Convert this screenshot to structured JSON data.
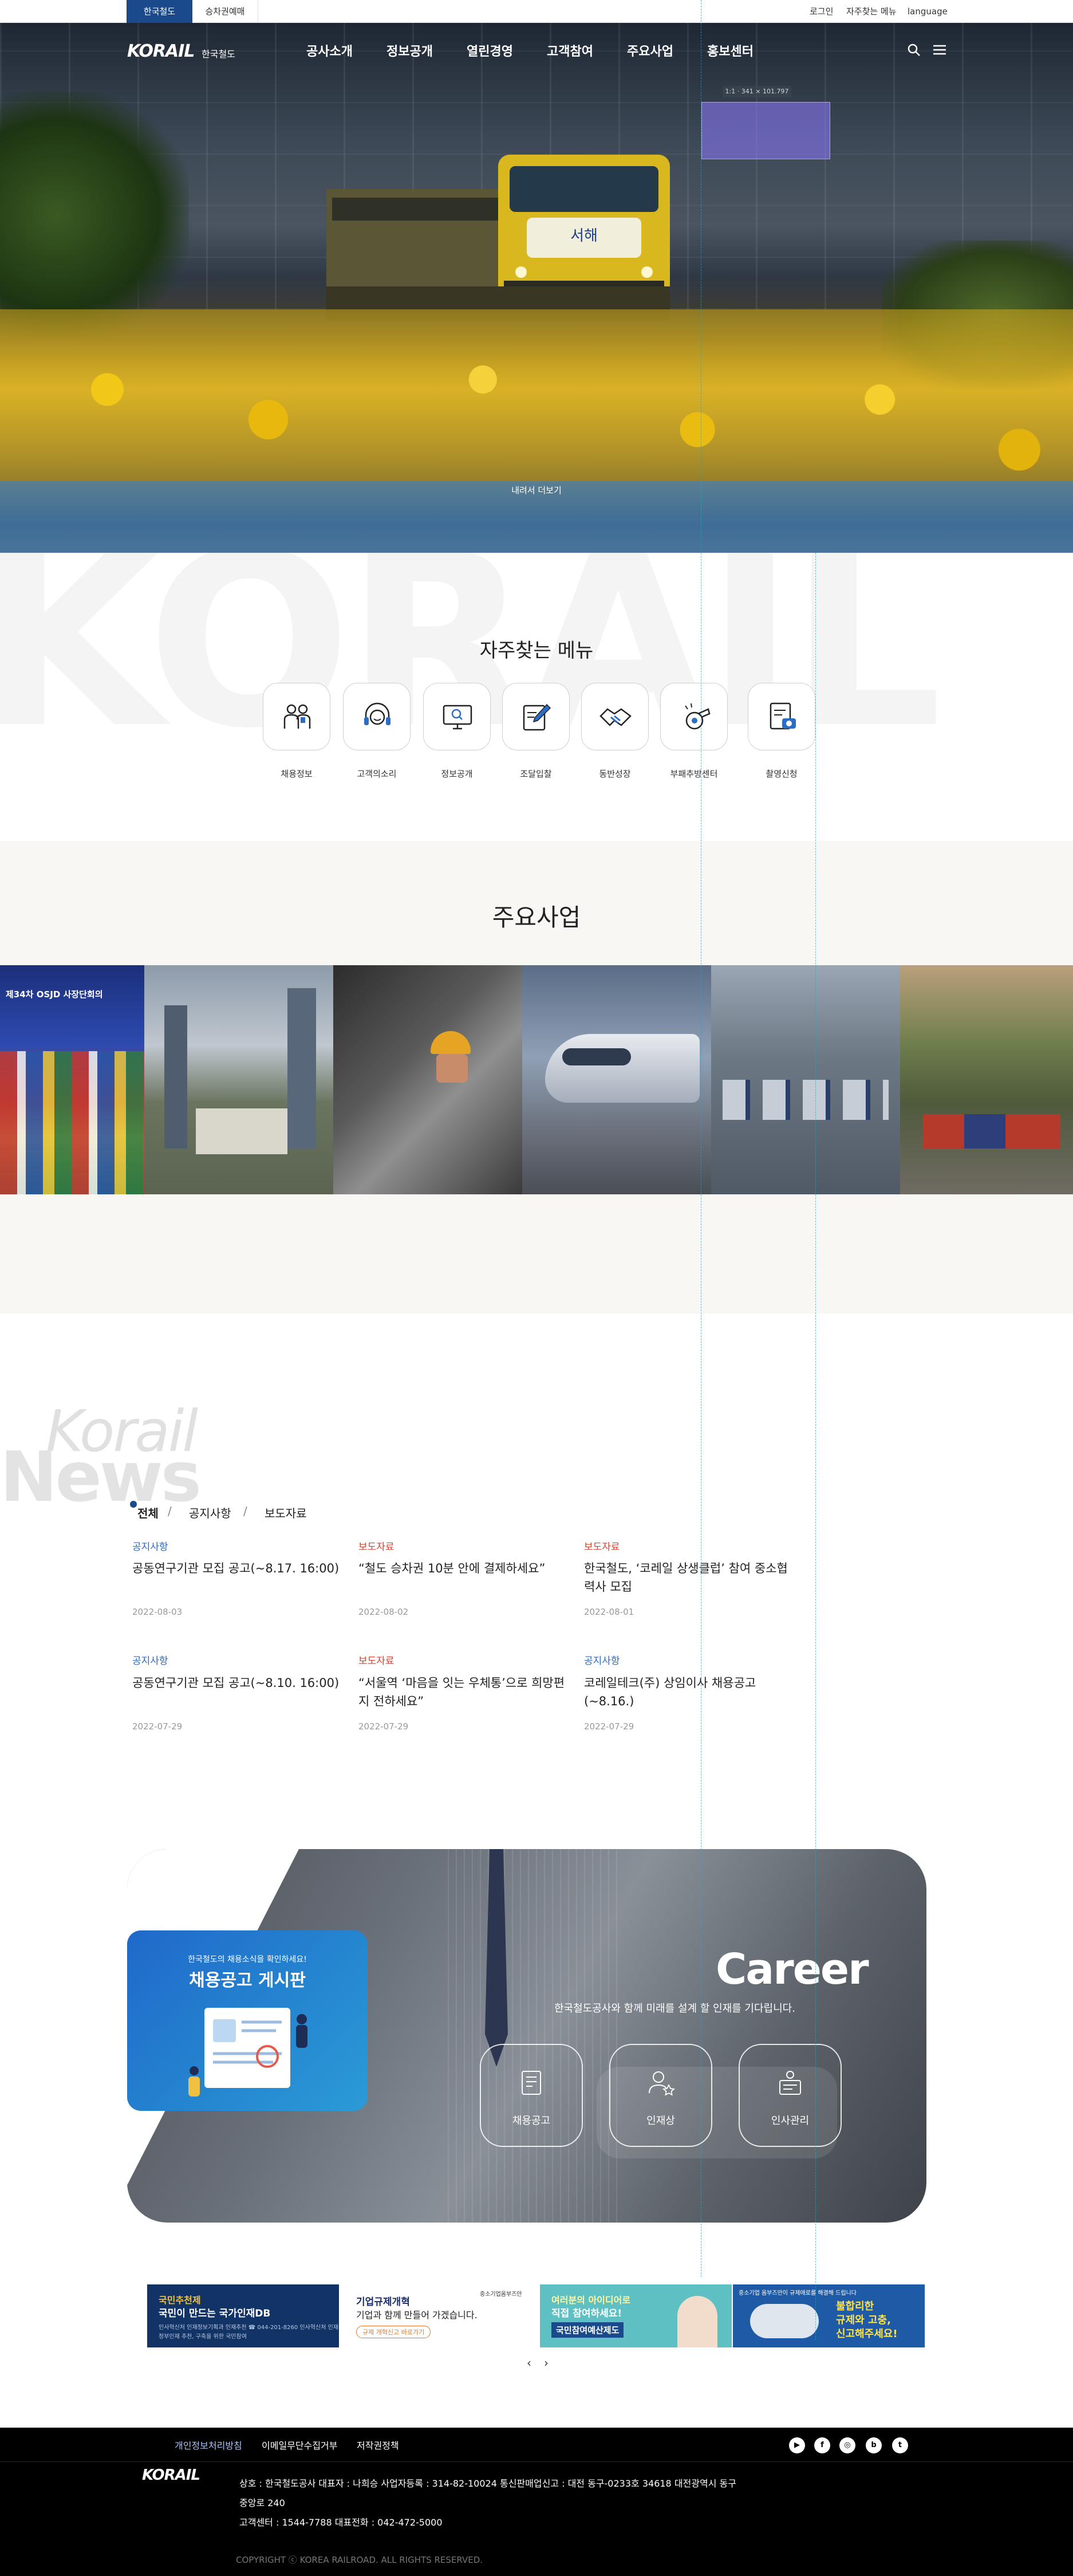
{
  "topbar": {
    "site_tabs": [
      "한국철도",
      "승차권예매"
    ],
    "util_links": [
      "로그인",
      "자주찾는 메뉴",
      "language"
    ]
  },
  "header": {
    "logo_word": "KORAIL",
    "logo_sub": "한국철도",
    "gnb": [
      "공사소개",
      "정보공개",
      "열린경영",
      "고객참여",
      "주요사업",
      "홍보센터"
    ],
    "icons": [
      "search-icon",
      "hamburger-menu-icon"
    ]
  },
  "hero": {
    "popup_text": "1:1 · 341 × 101.797",
    "more_label": "내려서 더보기"
  },
  "quick_menu": {
    "watermark": "KORAIL",
    "title": "자주찾는 메뉴",
    "items": [
      {
        "label": "채용정보",
        "icon": "people-icon"
      },
      {
        "label": "고객의소리",
        "icon": "headset-icon"
      },
      {
        "label": "정보공개",
        "icon": "monitor-search-icon"
      },
      {
        "label": "조달입찰",
        "icon": "document-pen-icon"
      },
      {
        "label": "동반성장",
        "icon": "handshake-icon"
      },
      {
        "label": "부패추방센터",
        "icon": "whistle-icon"
      },
      {
        "label": "촬영신청",
        "icon": "camera-document-icon"
      }
    ]
  },
  "business": {
    "title": "주요사업",
    "images": [
      {
        "name": "flags-conference-image",
        "caption": "제34차 OSJD 사장단회의"
      },
      {
        "name": "city-development-image",
        "caption": ""
      },
      {
        "name": "worker-maintenance-image",
        "caption": ""
      },
      {
        "name": "ktx-train-image",
        "caption": ""
      },
      {
        "name": "train-depot-image",
        "caption": ""
      },
      {
        "name": "freight-train-image",
        "caption": ""
      }
    ]
  },
  "news": {
    "watermark_top": "Korail",
    "watermark_bottom": "News",
    "tabs": [
      "전체",
      "공지사항",
      "보도자료"
    ],
    "separators": [
      "/",
      "/"
    ],
    "items": [
      {
        "category": "공지사항",
        "title": "공동연구기관 모집 공고(~8.17. 16:00)",
        "date": "2022-08-03"
      },
      {
        "category": "보도자료",
        "title": "“철도 승차권 10분 안에 결제하세요”",
        "date": "2022-08-02"
      },
      {
        "category": "보도자료",
        "title": "한국철도, ‘코레일 상생클럽’ 참여 중소협력사 모집",
        "date": "2022-08-01"
      },
      {
        "category": "공지사항",
        "title": "공동연구기관 모집 공고(~8.10. 16:00)",
        "date": "2022-07-29"
      },
      {
        "category": "보도자료",
        "title": "“서울역 ‘마음을 잇는 우체통’으로 희망편지 전하세요”",
        "date": "2022-07-29"
      },
      {
        "category": "공지사항",
        "title": "코레일테크(주) 상임이사 채용공고(~8.16.)",
        "date": "2022-07-29"
      }
    ],
    "colors": {
      "notice": "#2b6cc4",
      "press": "#d9402b"
    }
  },
  "career": {
    "card_small": "한국철도의 채용소식을 확인하세요!",
    "card_title": "채용공고 게시판",
    "title": "Career",
    "subtitle": "한국철도공사와 함께 미래를 설계 할 인재를 기다립니다.",
    "buttons": [
      {
        "label": "채용공고",
        "icon": "notice-board-icon"
      },
      {
        "label": "인재상",
        "icon": "person-star-icon"
      },
      {
        "label": "인사관리",
        "icon": "hr-management-icon"
      }
    ]
  },
  "banners": [
    {
      "name": "national-talent-db-banner",
      "line1": "국민추천제",
      "line2": "국민이 만드는 국가인재DB",
      "line3": "인사혁신처 인재정보기획과 인재추천 ☎ 044-201-8260 인사혁신처 인재정보",
      "line4": "정부인재 추천, 구축을 위한 국민참여"
    },
    {
      "name": "regulation-reform-banner",
      "org": "중소기업옴부즈만",
      "line1": "기업규제개혁",
      "line2": "기업과 함께 만들어 가겠습니다.",
      "line3": "규제 개혁신고 바로가기"
    },
    {
      "name": "public-budget-banner",
      "line1": "여러분의 아이디어로",
      "line2": "직접 참여하세요!",
      "line3": "국민참여예산제도"
    },
    {
      "name": "ombudsman-banner",
      "line1": "중소기업 옴부즈만이 규제애로를 해결해 드립니다",
      "line2": "불합리한",
      "line3": "규제와 고충,",
      "line4": "신고해주세요!"
    }
  ],
  "pager": {
    "prev": "‹",
    "next": "›"
  },
  "footer": {
    "links": [
      "개인정보처리방침",
      "이메일무단수집거부",
      "저작권정책"
    ],
    "sns": [
      {
        "name": "youtube-icon",
        "glyph": "▶"
      },
      {
        "name": "facebook-icon",
        "glyph": "f"
      },
      {
        "name": "instagram-icon",
        "glyph": "◎"
      },
      {
        "name": "blog-icon",
        "glyph": "b"
      },
      {
        "name": "twitter-icon",
        "glyph": "t"
      }
    ],
    "logo_word": "KORAIL",
    "info_line1": "상호 : 한국철도공사     대표자 : 나희승     사업자등록 : 314-82-10024     통신판매업신고 : 대전 동구-0233호  34618 대전광역시 동구",
    "info_line2": "중앙로 240",
    "info_line3": "고객센터 : 1544-7788     대표전화 : 042-472-5000",
    "copyright": "COPYRIGHT ⓒ KOREA RAILROAD. ALL RIGHTS RESERVED."
  }
}
